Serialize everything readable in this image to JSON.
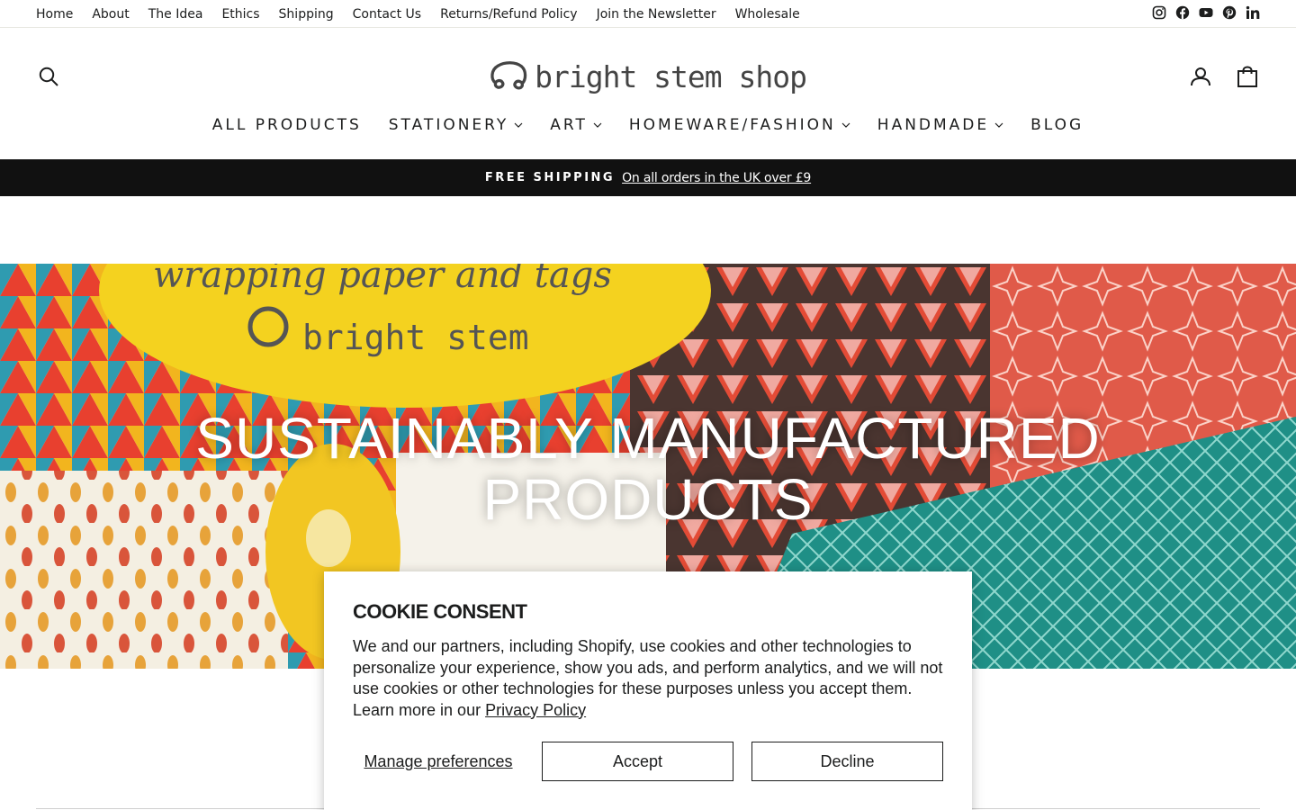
{
  "utility_nav": {
    "links": [
      "Home",
      "About",
      "The Idea",
      "Ethics",
      "Shipping",
      "Contact Us",
      "Returns/Refund Policy",
      "Join the Newsletter",
      "Wholesale"
    ],
    "social_icons": [
      "instagram-icon",
      "facebook-icon",
      "youtube-icon",
      "pinterest-icon",
      "linkedin-icon"
    ]
  },
  "header": {
    "logo_text": "bright stem shop",
    "search_icon": "search-icon",
    "account_icon": "user-icon",
    "cart_icon": "bag-icon"
  },
  "main_nav": {
    "items": [
      {
        "label": "ALL PRODUCTS",
        "has_dropdown": false
      },
      {
        "label": "STATIONERY",
        "has_dropdown": true
      },
      {
        "label": "ART",
        "has_dropdown": true
      },
      {
        "label": "HOMEWARE/FASHION",
        "has_dropdown": true
      },
      {
        "label": "HANDMADE",
        "has_dropdown": true
      },
      {
        "label": "BLOG",
        "has_dropdown": false
      }
    ]
  },
  "announcement": {
    "strong": "FREE SHIPPING",
    "link": "On all orders in the UK over £9"
  },
  "hero": {
    "title_line1": "SUSTAINABLY MANUFACTURED",
    "title_line2": "PRODUCTS",
    "image_lettering": [
      "wrapping paper and tags",
      "bright stem"
    ]
  },
  "cookie": {
    "title": "COOKIE CONSENT",
    "body": "We and our partners, including Shopify, use cookies and other technologies to personalize your experience, show you ads, and perform analytics, and we will not use cookies or other technologies for these purposes unless you accept them. Learn more in our ",
    "privacy_link": "Privacy Policy",
    "manage_label": "Manage preferences",
    "accept_label": "Accept",
    "decline_label": "Decline"
  },
  "colors": {
    "text": "#1c1d1d",
    "announcement_bg": "#111111",
    "hero_yellow": "#f4d21f",
    "hero_teal": "#1f8f86"
  }
}
